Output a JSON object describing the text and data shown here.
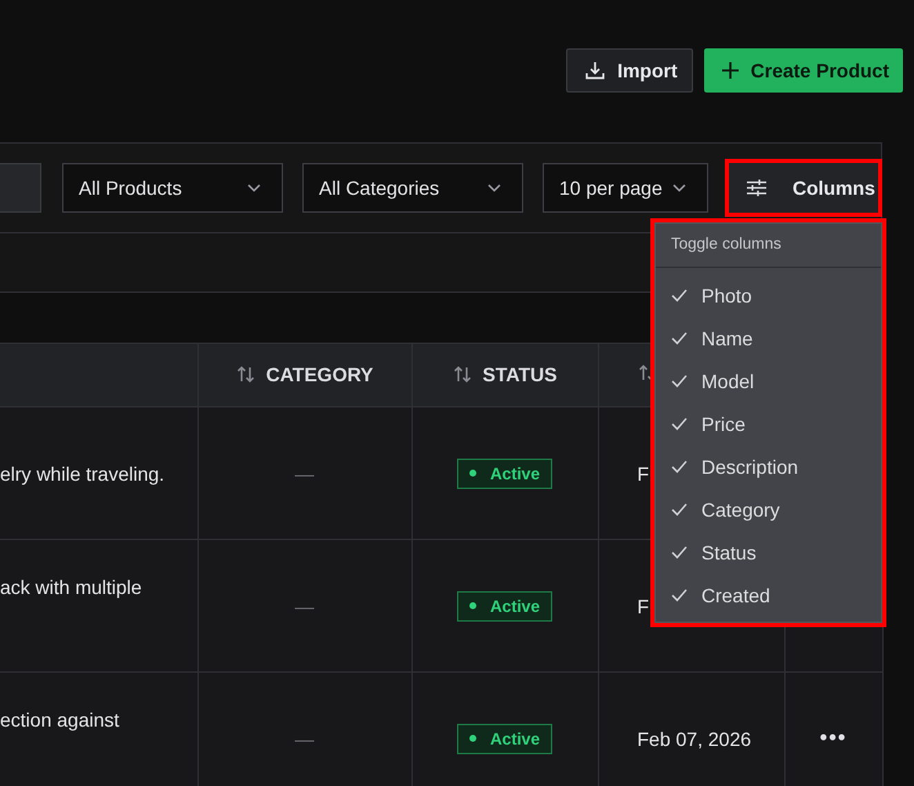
{
  "toolbar": {
    "buttons": [
      {
        "label": "Import",
        "kind": "secondary"
      },
      {
        "label": "Create Product",
        "kind": "primary"
      }
    ]
  },
  "filters": {
    "selects": [
      "All Products",
      "All Categories",
      "10 per page"
    ],
    "columns_button": {
      "label": "Columns",
      "highlighted": true
    }
  },
  "columns_menu": {
    "title": "Toggle columns",
    "highlighted": true,
    "items": [
      {
        "label": "Photo",
        "checked": true
      },
      {
        "label": "Name",
        "checked": true
      },
      {
        "label": "Model",
        "checked": true
      },
      {
        "label": "Price",
        "checked": true
      },
      {
        "label": "Description",
        "checked": true
      },
      {
        "label": "Category",
        "checked": true
      },
      {
        "label": "Status",
        "checked": true
      },
      {
        "label": "Created",
        "checked": true
      }
    ]
  },
  "table": {
    "columns": [
      {
        "label": "CATEGORY"
      },
      {
        "label": "STATUS"
      }
    ],
    "rows": [
      {
        "description": "elry while traveling.",
        "category": "—",
        "status": {
          "label": "Active",
          "kind": "active"
        },
        "created": "F"
      },
      {
        "description": "ack with multiple",
        "category": "—",
        "status": {
          "label": "Active",
          "kind": "active"
        },
        "created": "F"
      },
      {
        "description": "ection against",
        "category": "—",
        "status": {
          "label": "Active",
          "kind": "active"
        },
        "created": "Feb 07, 2026",
        "actions": "•••"
      }
    ]
  }
}
